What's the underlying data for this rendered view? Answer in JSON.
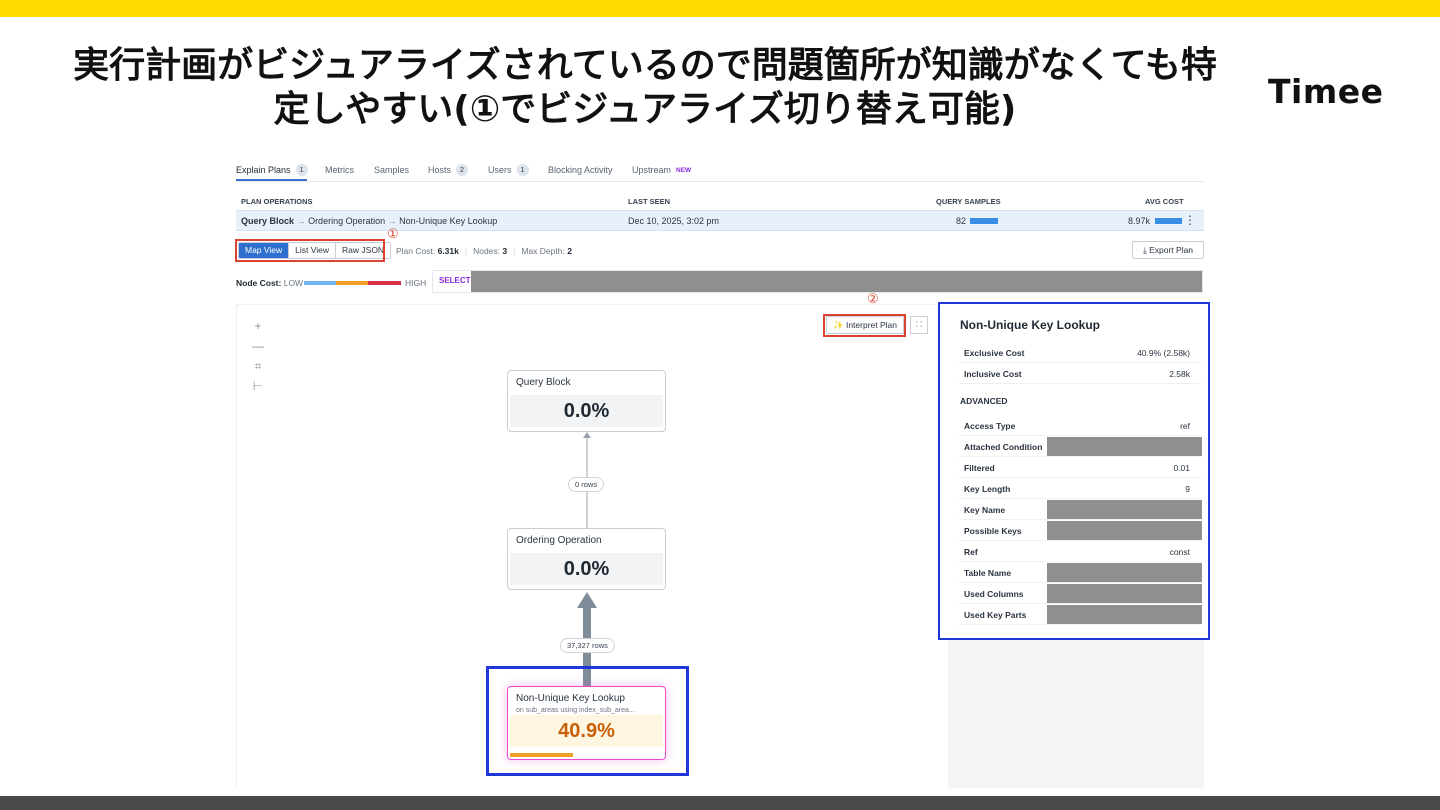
{
  "slide": {
    "title_line1": "実行計画がビジュアライズされているので問題箇所が知識がなくても特",
    "title_line2": "定しやすい(①でビジュアライズ切り替え可能)",
    "brand": "Timee"
  },
  "colors": {
    "accent_band": "#ffdc00",
    "annotation_red": "#d9432f",
    "highlight_blue": "#2136d9",
    "hot_node": "#e84bd0"
  },
  "tabs": [
    {
      "label": "Explain Plans",
      "count": "1"
    },
    {
      "label": "Metrics"
    },
    {
      "label": "Samples"
    },
    {
      "label": "Hosts",
      "count": "2"
    },
    {
      "label": "Users",
      "count": "1"
    },
    {
      "label": "Blocking Activity"
    },
    {
      "label": "Upstream",
      "badge": "NEW"
    }
  ],
  "table": {
    "headers": {
      "plan_operations": "PLAN OPERATIONS",
      "last_seen": "LAST SEEN",
      "query_samples": "QUERY SAMPLES",
      "avg_cost": "AVG COST"
    },
    "row": {
      "op1": "Query Block",
      "arrow": "→",
      "op2": "Ordering Operation",
      "op3": "Non-Unique Key Lookup",
      "last_seen": "Dec 10, 2025, 3:02 pm",
      "query_samples": "82",
      "avg_cost": "8.97k",
      "menu_icon": "⋮"
    }
  },
  "view": {
    "map": "Map View",
    "list": "List View",
    "raw": "Raw JSON",
    "marker": "①",
    "plan_cost_label": "Plan Cost:",
    "plan_cost": "6.31k",
    "nodes_label": "Nodes:",
    "nodes": "3",
    "depth_label": "Max Depth:",
    "depth": "2",
    "export": "Export Plan",
    "export_icon": "download-icon"
  },
  "node_cost": {
    "label": "Node Cost:",
    "low": "LOW",
    "high": "HIGH",
    "select": "SELECT"
  },
  "canvas": {
    "interpret": "Interpret Plan",
    "interpret_icon": "magic-wand-icon",
    "marker": "②",
    "zoom_in": "+",
    "zoom_out": "—",
    "fit_icon": "⌗",
    "tree_icon": "⊢",
    "expand_icon": "⛶"
  },
  "nodes": [
    {
      "title": "Query Block",
      "value": "0.0%"
    },
    {
      "title": "Ordering Operation",
      "value": "0.0%"
    },
    {
      "title": "Non-Unique Key Lookup",
      "subtitle": "on sub_areas using index_sub_area...",
      "value": "40.9%",
      "cost_fraction": 0.409
    }
  ],
  "edges": {
    "top": "0 rows",
    "bottom": "37,327 rows"
  },
  "panel": {
    "title": "Non-Unique Key Lookup",
    "exclusive_label": "Exclusive Cost",
    "exclusive": "40.9% (2.58k)",
    "inclusive_label": "Inclusive Cost",
    "inclusive": "2.58k",
    "advanced": "ADVANCED",
    "rows": [
      {
        "k": "Access Type",
        "v": "ref"
      },
      {
        "k": "Attached Condition",
        "redacted": true
      },
      {
        "k": "Filtered",
        "v": "0.01"
      },
      {
        "k": "Key Length",
        "v": "9"
      },
      {
        "k": "Key Name",
        "redacted": true
      },
      {
        "k": "Possible Keys",
        "redacted": true
      },
      {
        "k": "Ref",
        "v": "const"
      },
      {
        "k": "Table Name",
        "redacted": true
      },
      {
        "k": "Used Columns",
        "redacted": true
      },
      {
        "k": "Used Key Parts",
        "redacted": true
      }
    ]
  }
}
